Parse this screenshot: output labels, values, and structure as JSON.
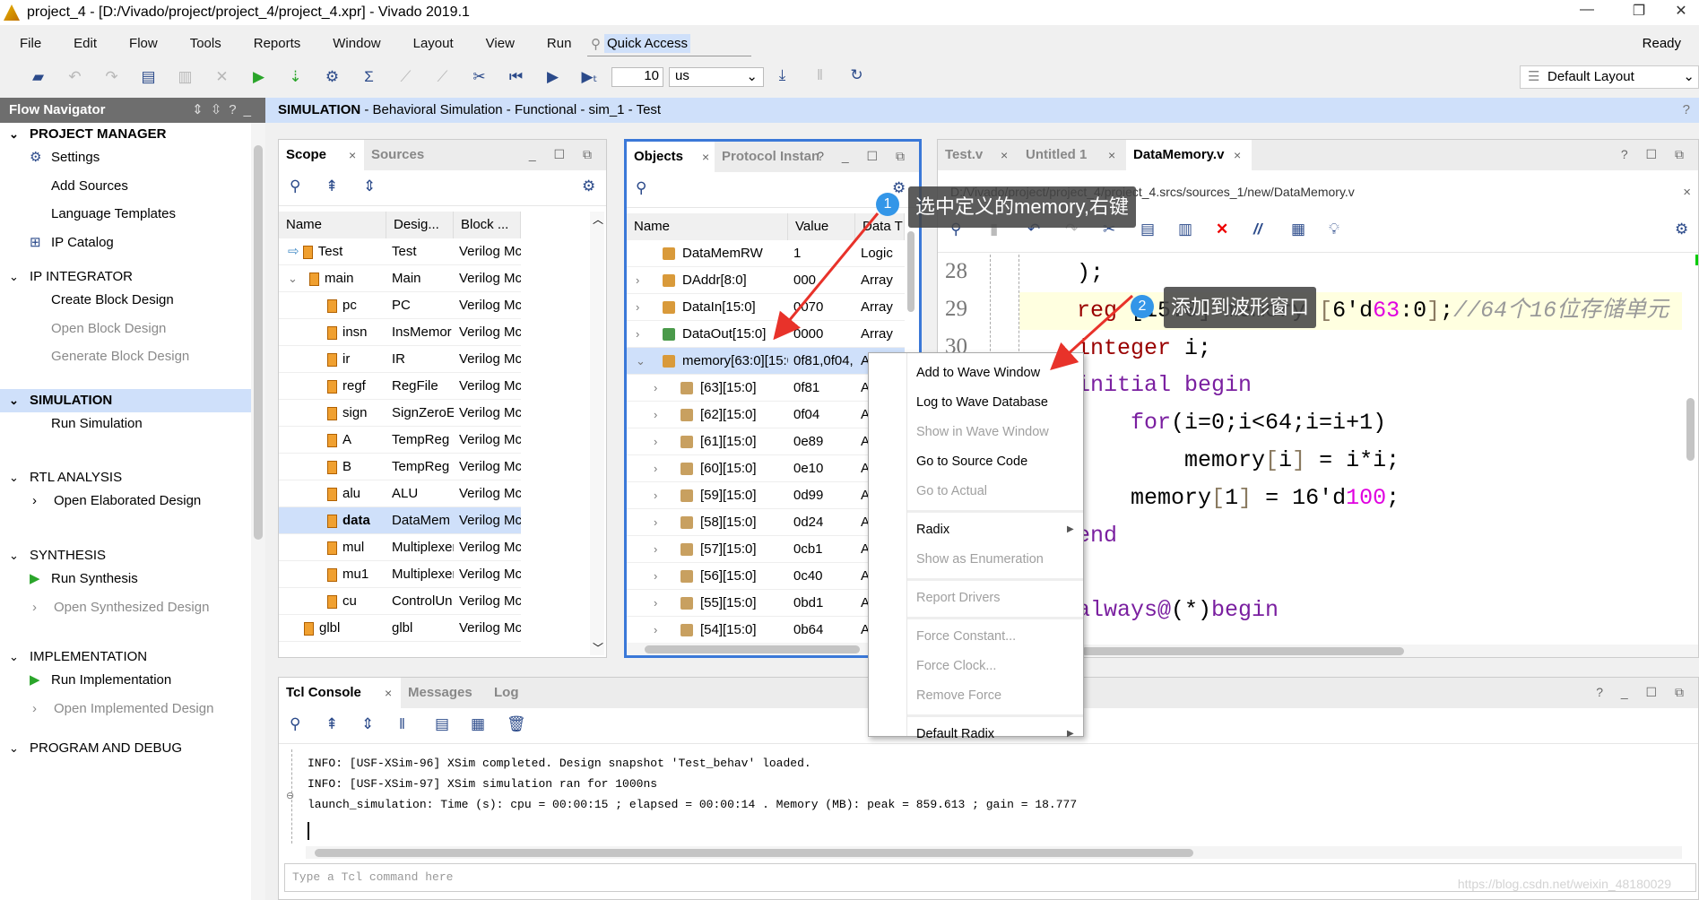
{
  "window": {
    "title": "project_4 - [D:/Vivado/project/project_4/project_4.xpr] - Vivado 2019.1",
    "controls": [
      "—",
      "❐",
      "✕"
    ]
  },
  "menubar": {
    "items": [
      "File",
      "Edit",
      "Flow",
      "Tools",
      "Reports",
      "Window",
      "Layout",
      "View",
      "Run",
      "Help"
    ],
    "quick_access": "Quick Access",
    "status": "Ready"
  },
  "toolbar": {
    "time_value": "10",
    "time_unit": "us",
    "layout": "Default Layout"
  },
  "flow_navigator": {
    "title": "Flow Navigator",
    "sections": [
      {
        "label": "PROJECT MANAGER",
        "items": [
          {
            "label": "Settings",
            "icon": "gear-icon"
          },
          {
            "label": "Add Sources"
          },
          {
            "label": "Language Templates"
          },
          {
            "label": "IP Catalog",
            "icon": "ip-icon"
          }
        ]
      },
      {
        "label": "IP INTEGRATOR",
        "items": [
          {
            "label": "Create Block Design"
          },
          {
            "label": "Open Block Design",
            "disabled": true
          },
          {
            "label": "Generate Block Design",
            "disabled": true
          }
        ]
      },
      {
        "label": "SIMULATION",
        "active": true,
        "items": [
          {
            "label": "Run Simulation"
          }
        ]
      },
      {
        "label": "RTL ANALYSIS",
        "items": [
          {
            "label": "Open Elaborated Design",
            "expand": true
          }
        ]
      },
      {
        "label": "SYNTHESIS",
        "items": [
          {
            "label": "Run Synthesis",
            "icon": "run-icon"
          },
          {
            "label": "Open Synthesized Design",
            "expand": true,
            "disabled": true
          }
        ]
      },
      {
        "label": "IMPLEMENTATION",
        "items": [
          {
            "label": "Run Implementation",
            "icon": "run-icon"
          },
          {
            "label": "Open Implemented Design",
            "expand": true,
            "disabled": true
          }
        ]
      },
      {
        "label": "PROGRAM AND DEBUG",
        "items": []
      }
    ]
  },
  "banner": {
    "title": "SIMULATION",
    "subtitle": " - Behavioral Simulation - Functional - sim_1 - Test"
  },
  "scope": {
    "tabs": [
      "Scope",
      "Sources"
    ],
    "columns": [
      "Name",
      "Desig...",
      "Block ..."
    ],
    "rows": [
      {
        "name": "Test",
        "design": "Test",
        "block": "Verilog Mc",
        "depth": 0,
        "expanded": true,
        "top": true
      },
      {
        "name": "main",
        "design": "Main",
        "block": "Verilog Mc",
        "depth": 1,
        "expanded": true
      },
      {
        "name": "pc",
        "design": "PC",
        "block": "Verilog Mc",
        "depth": 2
      },
      {
        "name": "insn",
        "design": "InsMemor",
        "block": "Verilog Mc",
        "depth": 2
      },
      {
        "name": "ir",
        "design": "IR",
        "block": "Verilog Mc",
        "depth": 2
      },
      {
        "name": "regf",
        "design": "RegFile",
        "block": "Verilog Mc",
        "depth": 2
      },
      {
        "name": "sign",
        "design": "SignZeroE",
        "block": "Verilog Mc",
        "depth": 2
      },
      {
        "name": "A",
        "design": "TempReg",
        "block": "Verilog Mc",
        "depth": 2
      },
      {
        "name": "B",
        "design": "TempReg",
        "block": "Verilog Mc",
        "depth": 2
      },
      {
        "name": "alu",
        "design": "ALU",
        "block": "Verilog Mc",
        "depth": 2
      },
      {
        "name": "data",
        "design": "DataMem",
        "block": "Verilog Mc",
        "depth": 2,
        "selected": true
      },
      {
        "name": "mul",
        "design": "Multiplexer",
        "block": "Verilog Mc",
        "depth": 2
      },
      {
        "name": "mu1",
        "design": "Multiplexer",
        "block": "Verilog Mc",
        "depth": 2
      },
      {
        "name": "cu",
        "design": "ControlUn",
        "block": "Verilog Mc",
        "depth": 2
      },
      {
        "name": "glbl",
        "design": "glbl",
        "block": "Verilog Mc",
        "depth": 0
      }
    ]
  },
  "objects": {
    "tabs": [
      "Objects",
      "Protocol Instan"
    ],
    "columns": [
      "Name",
      "Value",
      "Data T"
    ],
    "rows": [
      {
        "name": "DataMemRW",
        "value": "1",
        "type": "Logic",
        "depth": 0,
        "expandable": false
      },
      {
        "name": "DAddr[8:0]",
        "value": "000",
        "type": "Array",
        "depth": 0,
        "expandable": true
      },
      {
        "name": "DataIn[15:0]",
        "value": "0070",
        "type": "Array",
        "depth": 0,
        "expandable": true
      },
      {
        "name": "DataOut[15:0]",
        "value": "0000",
        "type": "Array",
        "depth": 0,
        "expandable": true,
        "output": true
      },
      {
        "name": "memory[63:0][15:0]",
        "value": "0f81,0f04,",
        "type": "A",
        "depth": 0,
        "expandable": true,
        "expanded": true,
        "selected": true
      },
      {
        "name": "[63][15:0]",
        "value": "0f81",
        "type": "A",
        "depth": 1,
        "expandable": true
      },
      {
        "name": "[62][15:0]",
        "value": "0f04",
        "type": "A",
        "depth": 1,
        "expandable": true
      },
      {
        "name": "[61][15:0]",
        "value": "0e89",
        "type": "A",
        "depth": 1,
        "expandable": true
      },
      {
        "name": "[60][15:0]",
        "value": "0e10",
        "type": "A",
        "depth": 1,
        "expandable": true
      },
      {
        "name": "[59][15:0]",
        "value": "0d99",
        "type": "A",
        "depth": 1,
        "expandable": true
      },
      {
        "name": "[58][15:0]",
        "value": "0d24",
        "type": "A",
        "depth": 1,
        "expandable": true
      },
      {
        "name": "[57][15:0]",
        "value": "0cb1",
        "type": "A",
        "depth": 1,
        "expandable": true
      },
      {
        "name": "[56][15:0]",
        "value": "0c40",
        "type": "A",
        "depth": 1,
        "expandable": true
      },
      {
        "name": "[55][15:0]",
        "value": "0bd1",
        "type": "A",
        "depth": 1,
        "expandable": true
      },
      {
        "name": "[54][15:0]",
        "value": "0b64",
        "type": "A",
        "depth": 1,
        "expandable": true
      }
    ]
  },
  "editor": {
    "tabs": [
      "Test.v",
      "Untitled 1",
      "DataMemory.v"
    ],
    "active_tab": 2,
    "path": "D:/Vivado/project/project_4/project_4.srcs/sources_1/new/DataMemory.v",
    "line_numbers": [
      "28",
      "29",
      "30"
    ],
    "lines": [
      [
        {
          "t": "    );",
          "c": ""
        }
      ],
      [
        {
          "t": "    reg",
          "c": "kw"
        },
        {
          "t": " [15:0] memory ",
          "c": ""
        },
        {
          "t": "[",
          "c": "br"
        },
        {
          "t": "6'd",
          "c": ""
        },
        {
          "t": "63",
          "c": "num"
        },
        {
          "t": ":0",
          "c": ""
        },
        {
          "t": "]",
          "c": "br"
        },
        {
          "t": ";",
          "c": ""
        },
        {
          "t": "//64个16位存储单元",
          "c": "cm"
        }
      ],
      [
        {
          "t": "    integer",
          "c": "kw"
        },
        {
          "t": " i;",
          "c": ""
        }
      ],
      [
        {
          "t": "    initial begin",
          "c": "kw2"
        }
      ],
      [
        {
          "t": "        for",
          "c": "kw2"
        },
        {
          "t": "(i=0;i<64;i=i+1)",
          "c": ""
        }
      ],
      [
        {
          "t": "            memory",
          "c": ""
        },
        {
          "t": "[",
          "c": "br"
        },
        {
          "t": "i",
          "c": ""
        },
        {
          "t": "]",
          "c": "br"
        },
        {
          "t": " = i*i;",
          "c": ""
        }
      ],
      [
        {
          "t": "        memory",
          "c": ""
        },
        {
          "t": "[",
          "c": "br"
        },
        {
          "t": "1",
          "c": ""
        },
        {
          "t": "]",
          "c": "br"
        },
        {
          "t": " = 16'd",
          "c": ""
        },
        {
          "t": "100",
          "c": "num"
        },
        {
          "t": ";",
          "c": ""
        }
      ],
      [
        {
          "t": "    end",
          "c": "kw2"
        }
      ],
      [
        {
          "t": "",
          "c": ""
        }
      ],
      [
        {
          "t": "    always@",
          "c": "kw2"
        },
        {
          "t": "(*)",
          "c": ""
        },
        {
          "t": "begin",
          "c": "kw2"
        }
      ]
    ]
  },
  "context_menu": {
    "items": [
      {
        "label": "Add to Wave Window"
      },
      {
        "label": "Log to Wave Database"
      },
      {
        "label": "Show in Wave Window",
        "disabled": true
      },
      {
        "label": "Go to Source Code"
      },
      {
        "label": "Go to Actual",
        "disabled": true
      },
      {
        "sep": true
      },
      {
        "label": "Radix",
        "submenu": true
      },
      {
        "label": "Show as Enumeration",
        "disabled": true
      },
      {
        "sep": true
      },
      {
        "label": "Report Drivers",
        "disabled": true
      },
      {
        "sep": true
      },
      {
        "label": "Force Constant...",
        "disabled": true
      },
      {
        "label": "Force Clock...",
        "disabled": true
      },
      {
        "label": "Remove Force",
        "disabled": true
      },
      {
        "sep": true
      },
      {
        "label": "Default Radix",
        "submenu": true
      }
    ]
  },
  "annotations": [
    {
      "badge": "1",
      "text": "选中定义的memory,右键"
    },
    {
      "badge": "2",
      "text": "添加到波形窗口"
    }
  ],
  "console": {
    "tabs": [
      "Tcl Console",
      "Messages",
      "Log"
    ],
    "lines": [
      "INFO: [USF-XSim-96] XSim completed. Design snapshot 'Test_behav' loaded.",
      "INFO: [USF-XSim-97] XSim simulation ran for 1000ns",
      "launch_simulation: Time (s): cpu = 00:00:15 ; elapsed = 00:00:14 . Memory (MB): peak = 859.613 ; gain = 18.777"
    ],
    "input_placeholder": "Type a Tcl command here"
  },
  "watermark": "https://blog.csdn.net/weixin_48180029",
  "colors": {
    "accent": "#3a78d8",
    "selection": "#cfe0fa",
    "annotation_arrow": "#e8322a",
    "badge": "#3396e8"
  }
}
